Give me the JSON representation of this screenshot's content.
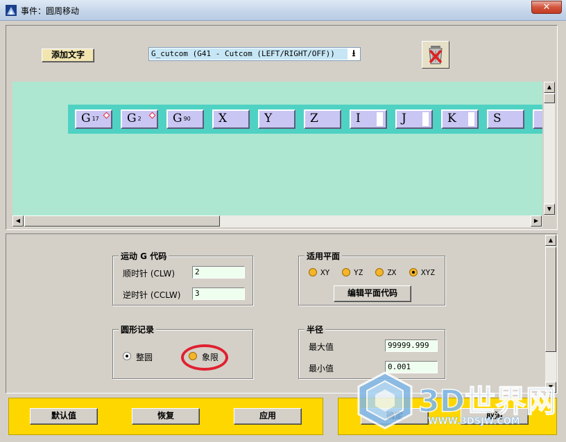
{
  "window": {
    "title": "事件：圆周移动",
    "close_glyph": "✕"
  },
  "toolbar": {
    "add_text_label": "添加文字",
    "gcode_select_value": "G_cutcom (G41 - Cutcom (LEFT/RIGHT/OFF))",
    "trash_icon": "trash-delete-icon"
  },
  "tokens": [
    {
      "letter": "G",
      "sub": "17",
      "mark": "diamond"
    },
    {
      "letter": "G",
      "sub": "2",
      "mark": "diamond"
    },
    {
      "letter": "G",
      "sub": "90",
      "mark": ""
    },
    {
      "letter": "X",
      "sub": "",
      "mark": ""
    },
    {
      "letter": "Y",
      "sub": "",
      "mark": ""
    },
    {
      "letter": "Z",
      "sub": "",
      "mark": ""
    },
    {
      "letter": "I",
      "sub": "",
      "mark": "slot"
    },
    {
      "letter": "J",
      "sub": "",
      "mark": "slot"
    },
    {
      "letter": "K",
      "sub": "",
      "mark": "slot"
    },
    {
      "letter": "S",
      "sub": "",
      "mark": ""
    }
  ],
  "motion_group": {
    "title": "运动 G 代码",
    "cw_label": "顺时针 (CLW)",
    "cw_value": "2",
    "ccw_label": "逆时针 (CCLW)",
    "ccw_value": "3"
  },
  "plane_group": {
    "title": "适用平面",
    "options": [
      "XY",
      "YZ",
      "ZX",
      "XYZ"
    ],
    "selected": "XYZ",
    "edit_button": "编辑平面代码"
  },
  "circle_group": {
    "title": "圆形记录",
    "options": [
      "整圆",
      "象限"
    ],
    "selected": "整圆"
  },
  "radius_group": {
    "title": "半径",
    "max_label": "最大值",
    "max_value": "99999.999",
    "min_label": "最小值",
    "min_value": "0.001"
  },
  "footer": {
    "default_label": "默认值",
    "restore_label": "恢复",
    "apply_label": "应用",
    "ok_label": "确定",
    "cancel_label": "取消"
  },
  "watermark": {
    "brand": "3D世界网",
    "url": "WWW.3DSJW.COM"
  },
  "colors": {
    "canvas_bg": "#ade7d1",
    "token_strip": "#4fd2c3",
    "token_face": "#c9c6f3",
    "footer_bar": "#ffd700",
    "highlight_ring": "#e02030"
  }
}
